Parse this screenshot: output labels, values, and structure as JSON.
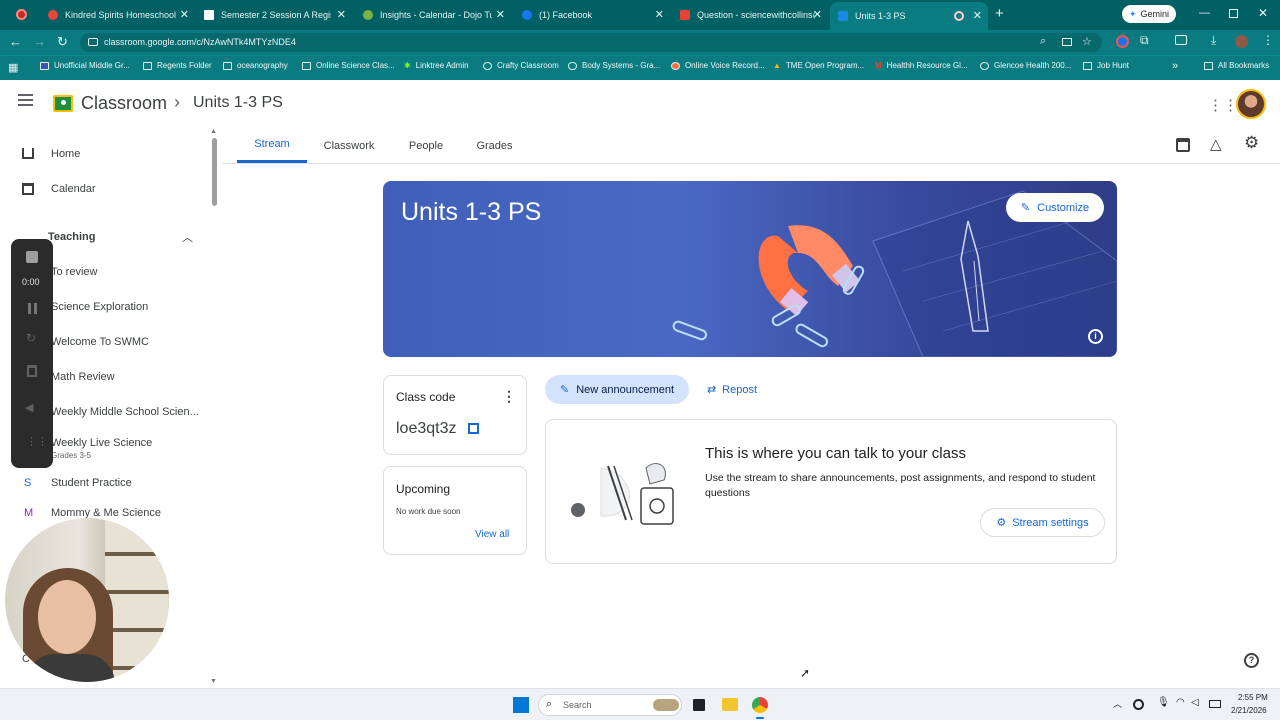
{
  "browser": {
    "tabs": [
      {
        "label": "Kindred Spirits Homeschool",
        "color": "#e8453c"
      },
      {
        "label": "Semester 2 Session A Registrati",
        "color": "#ffffff"
      },
      {
        "label": "Insights - Calendar - Dojo Tuto",
        "color": "#7cb342"
      },
      {
        "label": "(1) Facebook",
        "color": "#1877f2"
      },
      {
        "label": "Question - sciencewithcollins@",
        "color": "#ea4335"
      },
      {
        "label": "Units 1-3 PS",
        "color": "#1e88e5"
      }
    ],
    "new_tab": "+",
    "gemini": "Gemini",
    "url": "classroom.google.com/c/NzAwNTk4MTYzNDE4",
    "bookmarks": [
      "Unofficial Middle Gr...",
      "Regents Folder",
      "oceanography",
      "Online Science Clas...",
      "Linktree Admin",
      "Crafty Classroom",
      "Body Systems - Gra...",
      "Online Voice Record...",
      "TME Open Program...",
      "Healthh Resource Gl...",
      "Glencoe Health 200...",
      "Job Hunt"
    ],
    "more_bookmarks": "»",
    "all_bookmarks": "All Bookmarks"
  },
  "app": {
    "name": "Classroom",
    "breadcrumb_sep": "›",
    "class_name": "Units 1-3 PS"
  },
  "class_tabs": [
    "Stream",
    "Classwork",
    "People",
    "Grades"
  ],
  "sidebar": {
    "home": "Home",
    "calendar": "Calendar",
    "teaching": "Teaching",
    "items": [
      {
        "label": "To review",
        "sub": ""
      },
      {
        "label": "Science Exploration",
        "sub": ""
      },
      {
        "label": "Welcome To SWMC",
        "sub": ""
      },
      {
        "label": "Math Review",
        "sub": ""
      },
      {
        "label": "Weekly Middle School Scien...",
        "sub": ""
      },
      {
        "label": "Weekly Live Science",
        "sub": "Grades 3-5"
      },
      {
        "label": "Student Practice",
        "sub": "",
        "letter": "S"
      },
      {
        "label": "Mommy & Me Science",
        "sub": "",
        "letter": "M"
      }
    ]
  },
  "recorder": {
    "time": "0:00"
  },
  "banner": {
    "title": "Units 1-3 PS",
    "customize": "Customize"
  },
  "class_code": {
    "label": "Class code",
    "code": "loe3qt3z"
  },
  "upcoming": {
    "title": "Upcoming",
    "empty": "No work due soon",
    "view_all": "View all"
  },
  "actions": {
    "new_announcement": "New announcement",
    "repost": "Repost"
  },
  "stream_empty": {
    "heading": "This is where you can talk to your class",
    "body": "Use the stream to share announcements, post assignments, and respond to student questions",
    "settings": "Stream settings"
  },
  "taskbar": {
    "search": "Search",
    "time": "2:55 PM",
    "date": "2/21/2026"
  }
}
